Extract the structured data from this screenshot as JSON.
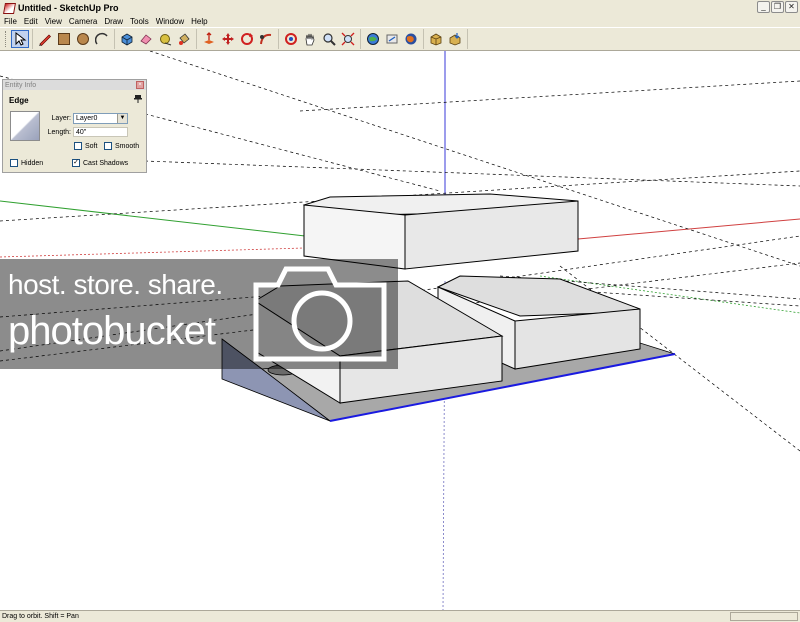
{
  "window": {
    "title": "Untitled - SketchUp Pro",
    "controls": [
      "_",
      "❐",
      "✕"
    ]
  },
  "menu": [
    "File",
    "Edit",
    "View",
    "Camera",
    "Draw",
    "Tools",
    "Window",
    "Help"
  ],
  "toolbar": {
    "tools": [
      {
        "name": "select-tool",
        "icon": "arrow-icon",
        "active": true
      },
      {
        "name": "line-tool",
        "icon": "pencil-icon"
      },
      {
        "name": "rectangle-tool",
        "icon": "rectangle-icon"
      },
      {
        "name": "circle-tool",
        "icon": "circle-icon"
      },
      {
        "name": "arc-tool",
        "icon": "arc-icon"
      },
      {
        "name": "make-component-tool",
        "icon": "component-icon"
      },
      {
        "name": "eraser-tool",
        "icon": "eraser-icon"
      },
      {
        "name": "tape-measure-tool",
        "icon": "tape-icon"
      },
      {
        "name": "paint-bucket-tool",
        "icon": "paint-bucket-icon"
      },
      {
        "name": "push-pull-tool",
        "icon": "push-pull-icon"
      },
      {
        "name": "move-tool",
        "icon": "move-icon"
      },
      {
        "name": "rotate-tool",
        "icon": "rotate-icon"
      },
      {
        "name": "follow-me-tool",
        "icon": "follow-me-icon"
      },
      {
        "name": "orbit-tool",
        "icon": "orbit-icon"
      },
      {
        "name": "pan-tool",
        "icon": "hand-icon"
      },
      {
        "name": "zoom-tool",
        "icon": "magnifier-icon"
      },
      {
        "name": "zoom-extents-tool",
        "icon": "zoom-extents-icon"
      },
      {
        "name": "get-models-tool",
        "icon": "globe-icon"
      },
      {
        "name": "share-model-tool",
        "icon": "share-icon"
      },
      {
        "name": "google-earth-tool",
        "icon": "earth-icon"
      },
      {
        "name": "component-share-tool",
        "icon": "box-icon"
      },
      {
        "name": "component-get-tool",
        "icon": "box-down-icon"
      }
    ]
  },
  "entity_info": {
    "title": "Entity Info",
    "close": "×",
    "type": "Edge",
    "layer_label": "Layer:",
    "layer_value": "Layer0",
    "length_label": "Length:",
    "length_value": "40\"",
    "soft_label": "Soft",
    "smooth_label": "Smooth",
    "hidden_label": "Hidden",
    "cast_shadows_label": "Cast Shadows",
    "soft_checked": false,
    "smooth_checked": false,
    "hidden_checked": false,
    "cast_shadows_checked": true
  },
  "status": {
    "hint": "Drag to orbit.  Shift = Pan"
  },
  "watermark": {
    "line1": "host. store. share.",
    "line2": "photobucket"
  },
  "colors": {
    "chrome": "#ece9d8",
    "axis_red": "#d04040",
    "axis_green": "#30a030",
    "axis_blue": "#3a3ad8",
    "selection_blue": "#1a1ae0"
  }
}
